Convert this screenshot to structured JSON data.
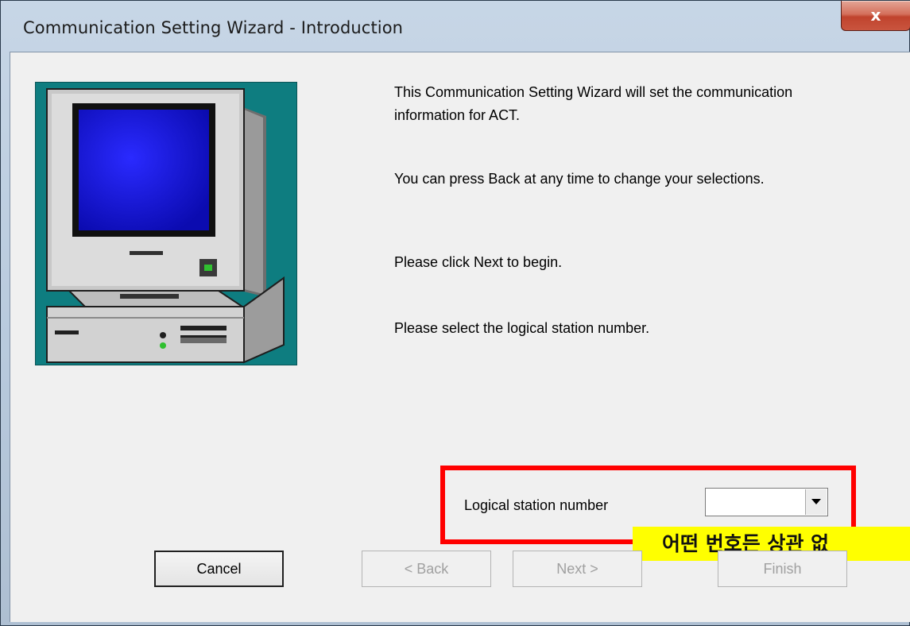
{
  "window": {
    "title": "Communication Setting Wizard - Introduction",
    "close_glyph": "x"
  },
  "image": {
    "icon": "desktop-computer-icon"
  },
  "paragraphs": [
    "This Communication Setting Wizard will set the communication information for ACT.",
    "You can press Back at any time to change your selections.",
    "Please click Next to begin.",
    "Please select the logical station number."
  ],
  "station": {
    "label": "Logical station number",
    "selected_value": ""
  },
  "annotation": {
    "text": "어떤 번호든 상관 없",
    "highlight_color": "#ff0000",
    "background_color": "#ffff00"
  },
  "buttons": {
    "cancel": "Cancel",
    "back": "< Back",
    "next": "Next >",
    "finish": "Finish"
  }
}
